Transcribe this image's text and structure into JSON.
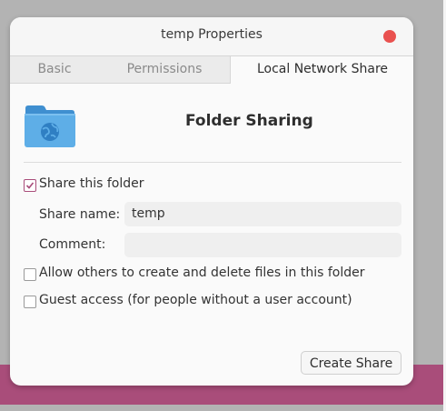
{
  "window": {
    "title": "temp Properties"
  },
  "tabs": [
    {
      "label": "Basic",
      "active": false
    },
    {
      "label": "Permissions",
      "active": false
    },
    {
      "label": "Local Network Share",
      "active": true
    }
  ],
  "header": {
    "icon": "folder-share-icon",
    "heading": "Folder Sharing"
  },
  "share_this_folder": {
    "label": "Share this folder",
    "checked": true
  },
  "share_name": {
    "label": "Share name:",
    "value": "temp"
  },
  "comment": {
    "label": "Comment:",
    "value": ""
  },
  "allow_others": {
    "label": "Allow others to create and delete files in this folder",
    "checked": false
  },
  "guest_access": {
    "label": "Guest access (for people without a user account)",
    "checked": false
  },
  "actions": {
    "create_share": "Create Share"
  },
  "colors": {
    "accent": "#a94d7a",
    "close": "#e9514f",
    "folder": "#5eaee7"
  }
}
